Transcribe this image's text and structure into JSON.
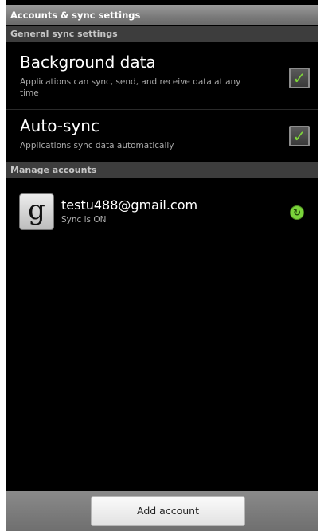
{
  "title": "Accounts & sync settings",
  "general": {
    "header": "General sync settings",
    "background_data": {
      "title": "Background data",
      "summary_line1": "Applications can sync, send, and receive data at any",
      "summary_line2": "time",
      "checked_mark": "✓"
    },
    "auto_sync": {
      "title": "Auto-sync",
      "summary": "Applications sync data automatically",
      "checked_mark": "✓"
    }
  },
  "manage": {
    "header": "Manage accounts",
    "account": {
      "icon_letter": "g",
      "email": "testu488@gmail.com",
      "status": "Sync is ON",
      "sync_icon_glyph": "↻"
    }
  },
  "bottom": {
    "add_account_label": "Add account"
  },
  "colors": {
    "check_green": "#7fd63a",
    "sync_green": "#7ad43b"
  }
}
